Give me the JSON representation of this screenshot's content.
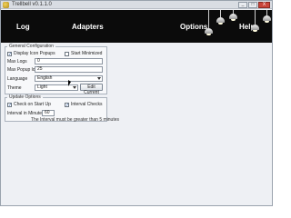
{
  "window": {
    "title": "Trellbell v0.1.1.0",
    "minimize_symbol": "_",
    "maximize_symbol": "□",
    "close_symbol": "X"
  },
  "header": {
    "nav": [
      {
        "label": "Log"
      },
      {
        "label": "Adapters"
      },
      {
        "label": "Options"
      },
      {
        "label": "Help"
      }
    ]
  },
  "general": {
    "legend": "General Configuration",
    "display_icon_popups": {
      "label": "Display Icon Popups",
      "checked": true,
      "mark": "✓"
    },
    "start_minimized": {
      "label": "Start Minimized",
      "checked": false,
      "mark": ""
    },
    "max_logs": {
      "label": "Max Logs",
      "value": "0"
    },
    "max_popup_logs": {
      "label": "Max Popup logs",
      "value": "25"
    },
    "language": {
      "label": "Language",
      "value": "English"
    },
    "theme": {
      "label": "Theme",
      "value": "Light"
    },
    "edit_current_label": "Edit Current"
  },
  "update": {
    "legend": "Update Options",
    "check_on_startup": {
      "label": "Check on Start Up",
      "checked": true,
      "mark": "✓"
    },
    "interval_checks": {
      "label": "Interval Checks",
      "checked": true,
      "mark": "✓"
    },
    "interval_minutes": {
      "label": "Interval in Minutes",
      "value": "60"
    },
    "note": "The Interval must be greater than 5 minutes"
  },
  "colors": {
    "header_bg": "#0b0b0b",
    "body_bg": "#eef0f4",
    "check_mark": "#1d4fa0"
  }
}
